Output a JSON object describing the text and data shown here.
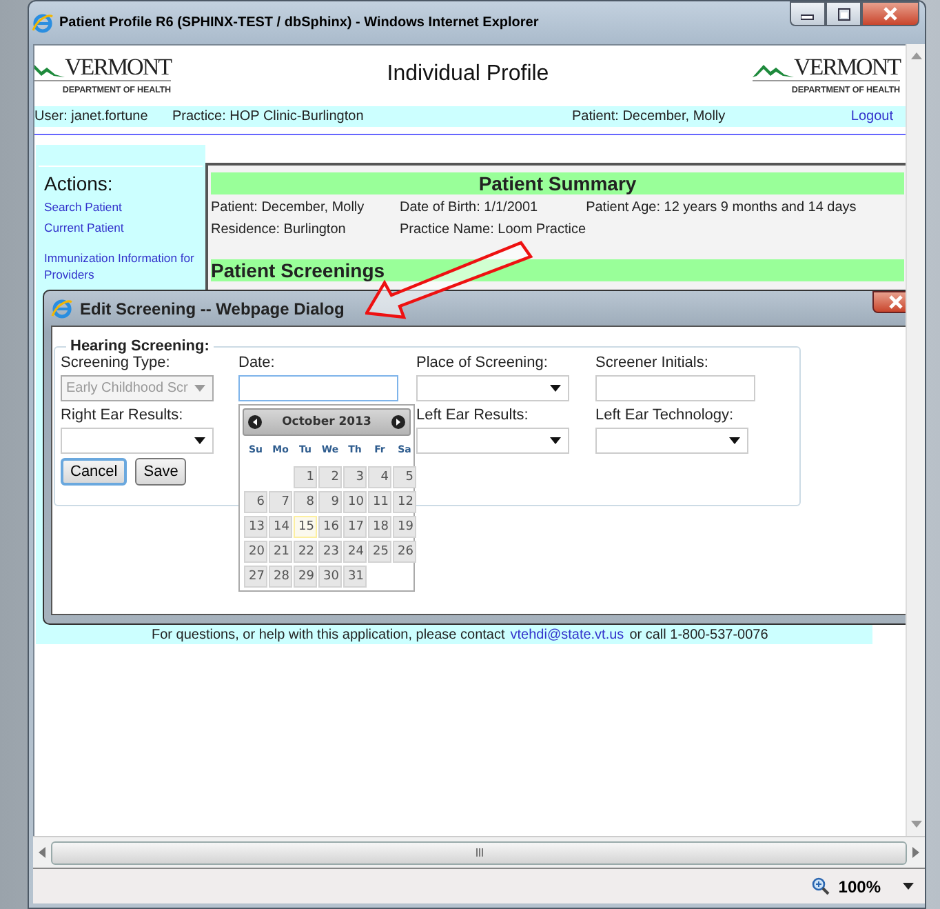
{
  "browser": {
    "title": "Patient Profile R6 (SPHINX-TEST / dbSphinx) - Windows Internet Explorer",
    "zoom": "100%"
  },
  "header": {
    "title": "Individual Profile",
    "logos": [
      {
        "name": "VERMONT",
        "subtitle": "DEPARTMENT OF HEALTH"
      },
      {
        "name": "VERMONT",
        "subtitle": "DEPARTMENT OF HEALTH"
      }
    ]
  },
  "user_bar": {
    "user": "User: janet.fortune",
    "practice": "Practice: HOP Clinic-Burlington",
    "patient": "Patient: December, Molly",
    "logout": "Logout"
  },
  "sidebar": {
    "heading": "Actions:",
    "items": [
      {
        "label": "Search Patient"
      },
      {
        "label": "Current Patient"
      },
      {
        "label": "Immunization Information for Providers"
      }
    ]
  },
  "summary": {
    "title": "Patient Summary",
    "rows": [
      [
        "Patient: December, Molly",
        "Date of Birth: 1/1/2001",
        "Patient Age: 12 years 9 months and 14 days"
      ],
      [
        "Residence: Burlington",
        "Practice Name: Loom Practice"
      ]
    ]
  },
  "screenings": {
    "title": "Patient Screenings"
  },
  "footer": {
    "text": "For questions, or help with this application, please contact",
    "email": "vtehdi@state.vt.us",
    "after": "or call 1-800-537-0076"
  },
  "dialog": {
    "title": "Edit Screening -- Webpage Dialog",
    "legend": "Hearing Screening:",
    "rows": [
      [
        {
          "label": "Screening Type:",
          "kind": "select",
          "value": "Early Childhood Scr",
          "disabled": true,
          "focused": false
        },
        {
          "label": "Date:",
          "kind": "text",
          "disabled": false,
          "focused": true
        },
        {
          "label": "Place of Screening:",
          "kind": "select",
          "disabled": false,
          "focused": false
        },
        {
          "label": "Screener Initials:",
          "kind": "text",
          "disabled": false,
          "focused": false
        }
      ],
      [
        {
          "label": "Right Ear Results:",
          "kind": "select",
          "disabled": false,
          "focused": false
        },
        null,
        {
          "label": "Left Ear Results:",
          "kind": "select",
          "disabled": false,
          "focused": false
        },
        {
          "label": "Left Ear Technology:",
          "kind": "select",
          "disabled": false,
          "focused": false
        }
      ]
    ],
    "buttons": [
      {
        "label": "Cancel",
        "focused": true
      },
      {
        "label": "Save",
        "focused": false
      }
    ]
  },
  "datepicker": {
    "open": true,
    "month": "October 2013",
    "weekdays": [
      "Su",
      "Mo",
      "Tu",
      "We",
      "Th",
      "Fr",
      "Sa"
    ],
    "weeks": [
      [
        {
          "label": "1",
          "today": false
        },
        {
          "label": "2",
          "today": false
        },
        {
          "label": "3",
          "today": false
        },
        {
          "label": "4",
          "today": false
        },
        {
          "label": "5",
          "today": false
        }
      ],
      [
        {
          "label": "6",
          "today": false
        },
        {
          "label": "7",
          "today": false
        },
        {
          "label": "8",
          "today": false
        },
        {
          "label": "9",
          "today": false
        },
        {
          "label": "10",
          "today": false
        },
        {
          "label": "11",
          "today": false
        },
        {
          "label": "12",
          "today": false
        }
      ],
      [
        {
          "label": "13",
          "today": false
        },
        {
          "label": "14",
          "today": false
        },
        {
          "label": "15",
          "today": true
        },
        {
          "label": "16",
          "today": false
        },
        {
          "label": "17",
          "today": false
        },
        {
          "label": "18",
          "today": false
        },
        {
          "label": "19",
          "today": false
        }
      ],
      [
        {
          "label": "20",
          "today": false
        },
        {
          "label": "21",
          "today": false
        },
        {
          "label": "22",
          "today": false
        },
        {
          "label": "23",
          "today": false
        },
        {
          "label": "24",
          "today": false
        },
        {
          "label": "25",
          "today": false
        },
        {
          "label": "26",
          "today": false
        }
      ],
      [
        {
          "label": "27",
          "today": false
        },
        {
          "label": "28",
          "today": false
        },
        {
          "label": "29",
          "today": false
        },
        {
          "label": "30",
          "today": false
        },
        {
          "label": "31",
          "today": false
        }
      ]
    ]
  }
}
